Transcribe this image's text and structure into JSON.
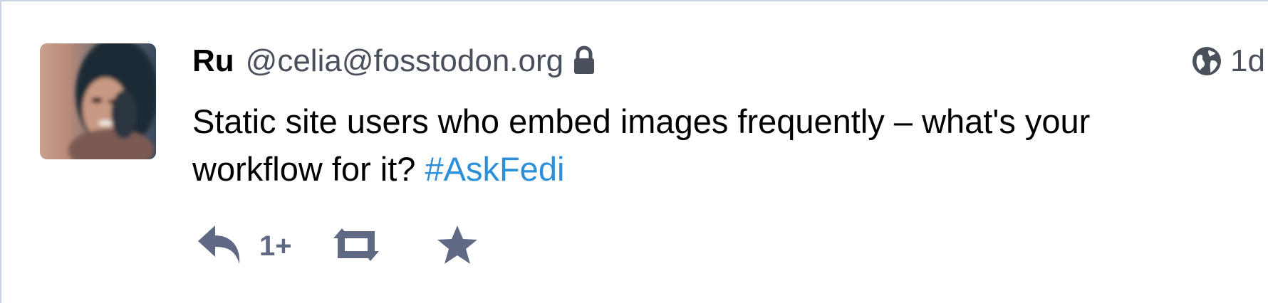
{
  "status": {
    "account": {
      "display_name": "Ru",
      "handle": "@celia@fosstodon.org",
      "locked_icon": "lock-icon"
    },
    "visibility_icon": "globe-icon",
    "timestamp": "1d",
    "content": {
      "text": "Static site users who embed images frequently – what's your workflow for it?",
      "hashtag": "#AskFedi"
    },
    "actions": {
      "reply_icon": "reply-icon",
      "reply_count": "1+",
      "boost_icon": "boost-icon",
      "favourite_icon": "star-icon"
    }
  },
  "colors": {
    "text": "#000000",
    "secondary": "#4a4f5c",
    "action": "#606984",
    "link": "#2b90d9",
    "border": "#c9d2e3"
  }
}
